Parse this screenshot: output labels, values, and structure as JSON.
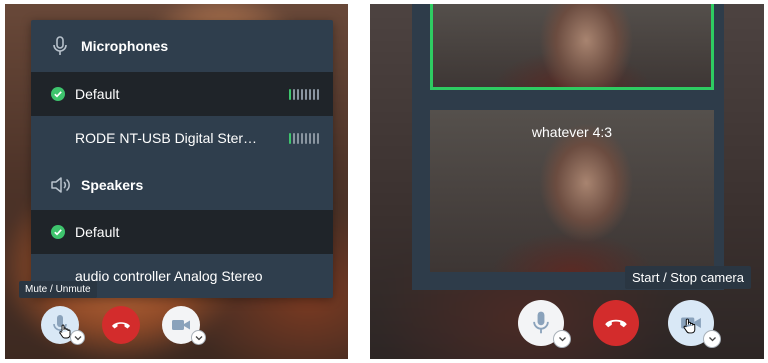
{
  "device_menu": {
    "microphones_header": "Microphones",
    "microphones": [
      {
        "label": "Default",
        "selected": true,
        "level_on": 1,
        "level_total": 8
      },
      {
        "label": "RODE NT-USB Digital Ster…",
        "selected": false,
        "level_on": 1,
        "level_total": 8
      }
    ],
    "speakers_header": "Speakers",
    "speakers": [
      {
        "label": "Default",
        "selected": true
      },
      {
        "label": "audio controller Analog Stereo",
        "selected": false
      }
    ]
  },
  "left_toolbar": {
    "tooltip": "Mute / Unmute",
    "buttons": [
      "microphone-icon",
      "hangup-icon",
      "camera-icon"
    ]
  },
  "right_view": {
    "tile_label": "whatever 4:3",
    "tooltip": "Start / Stop camera",
    "buttons": [
      "microphone-icon",
      "hangup-icon",
      "camera-icon"
    ]
  },
  "colors": {
    "menu_bg": "#2f3e4d",
    "selected_row": "#1f2429",
    "check_green": "#3ec46d",
    "hangup_red": "#d32c2c",
    "active_border": "#2ecc62"
  }
}
